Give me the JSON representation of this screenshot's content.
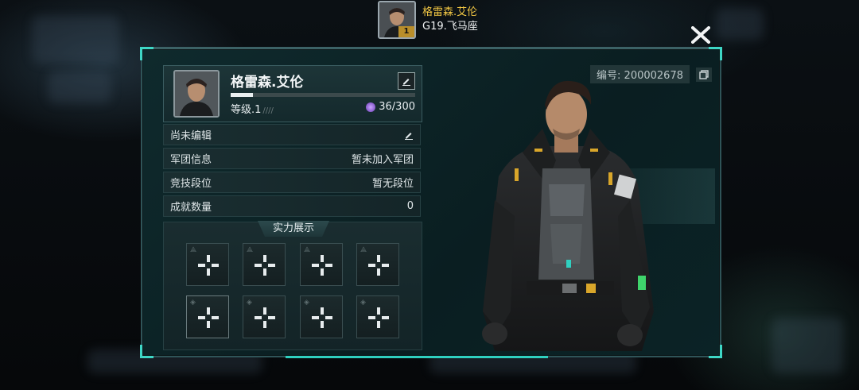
{
  "header": {
    "player_name": "格雷森.艾伦",
    "server": "G19.飞马座",
    "avatar_level": "1"
  },
  "profile": {
    "name": "格雷森.艾伦",
    "id_text": "编号: 200002678",
    "level_text": "等级.1",
    "exp_text": "36/300",
    "exp_fraction": 0.12
  },
  "info_rows": [
    {
      "label": "尚未编辑",
      "value": ""
    },
    {
      "label": "军团信息",
      "value": "暂未加入军团"
    },
    {
      "label": "竞技段位",
      "value": "暂无段位"
    },
    {
      "label": "成就数量",
      "value": "0"
    }
  ],
  "showcase": {
    "title": "实力展示"
  },
  "colors": {
    "accent": "#3ed7c6",
    "name_gold": "#f2c744",
    "exp_gem": "#8a55d6"
  },
  "icons": {
    "close": "close-icon",
    "edit": "edit-icon",
    "copy": "copy-icon",
    "add": "plus-icon"
  }
}
